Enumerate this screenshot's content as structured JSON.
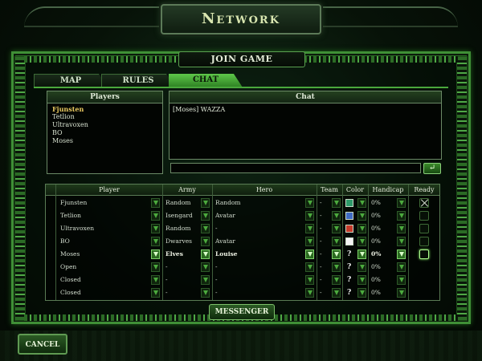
{
  "header": {
    "title": "Network",
    "subtitle": "JOIN GAME"
  },
  "tabs": [
    {
      "label": "MAP",
      "active": false
    },
    {
      "label": "RULES",
      "active": false
    },
    {
      "label": "CHAT",
      "active": true
    }
  ],
  "players_panel": {
    "header": "Players",
    "items": [
      "Fjunsten",
      "Tetlion",
      "Ultravoxen",
      "BO",
      "Moses"
    ]
  },
  "chat_panel": {
    "header": "Chat",
    "messages": [
      "[Moses] WAZZA"
    ],
    "input_value": "",
    "send_icon": "enter-arrow-icon"
  },
  "grid": {
    "columns": {
      "player": "Player",
      "army": "Army",
      "hero": "Hero",
      "team": "Team",
      "color": "Color",
      "handicap": "Handicap",
      "ready": "Ready"
    },
    "rows": [
      {
        "player": "Fjunsten",
        "army": "Random",
        "hero": "Random",
        "team": "-",
        "color": "#2e9a6a",
        "handicap": "0%",
        "ready": "checked"
      },
      {
        "player": "Tetlion",
        "army": "Isengard",
        "hero": "Avatar",
        "team": "-",
        "color": "#3f6bc4",
        "handicap": "0%",
        "ready": "empty"
      },
      {
        "player": "Ultravoxen",
        "army": "Random",
        "hero": "-",
        "team": "-",
        "color": "#c43a2a",
        "handicap": "0%",
        "ready": "empty"
      },
      {
        "player": "BO",
        "army": "Dwarves",
        "hero": "Avatar",
        "team": "-",
        "color": "#f4f4f4",
        "handicap": "0%",
        "ready": "empty"
      },
      {
        "player": "Moses",
        "army": "Elves",
        "hero": "Louise",
        "team": "-",
        "color": "?",
        "handicap": "0%",
        "ready": "highlight"
      },
      {
        "player": "Open",
        "army": "-",
        "hero": "-",
        "team": "-",
        "color": "?",
        "handicap": "0%",
        "ready": "none"
      },
      {
        "player": "Closed",
        "army": "-",
        "hero": "-",
        "team": "-",
        "color": "?",
        "handicap": "0%",
        "ready": "none"
      },
      {
        "player": "Closed",
        "army": "-",
        "hero": "-",
        "team": "-",
        "color": "?",
        "handicap": "0%",
        "ready": "none"
      }
    ]
  },
  "buttons": {
    "messenger": "MESSENGER",
    "cancel": "CANCEL"
  }
}
